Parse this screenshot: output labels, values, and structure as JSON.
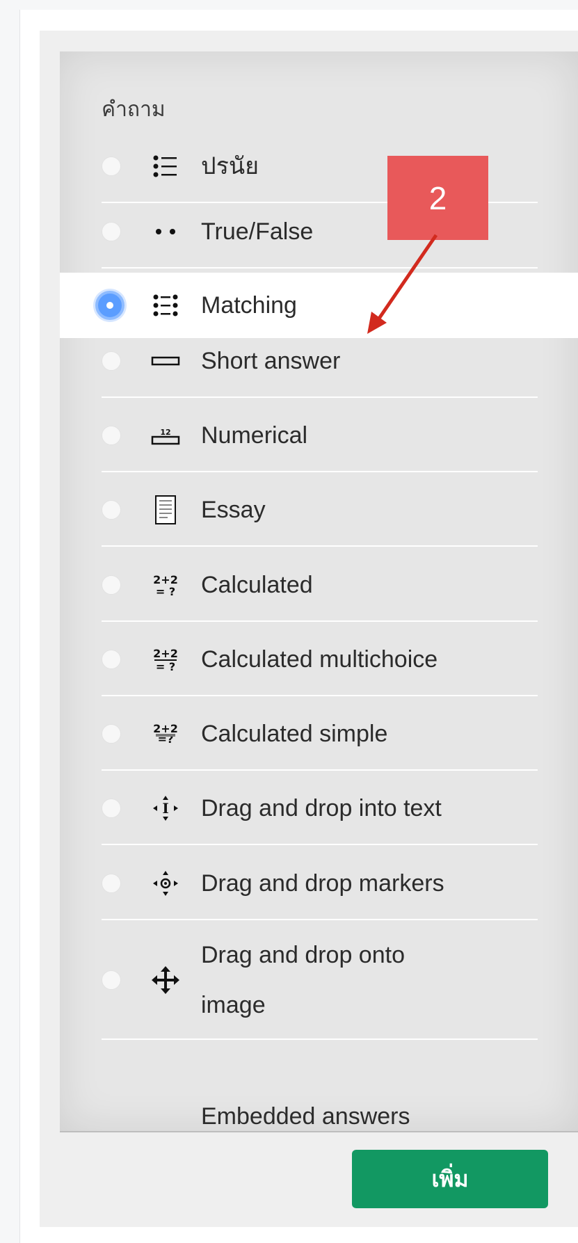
{
  "panel": {
    "section_title": "คำถาม",
    "items": [
      {
        "label": "ปรนัย",
        "icon": "multichoice-list-icon",
        "selected": false
      },
      {
        "label": "True/False",
        "icon": "two-dots-icon",
        "selected": false
      },
      {
        "label": "Matching",
        "icon": "matching-grid-icon",
        "selected": true
      },
      {
        "label": "Short answer",
        "icon": "text-box-icon",
        "selected": false
      },
      {
        "label": "Numerical",
        "icon": "numeric-box-icon",
        "selected": false
      },
      {
        "label": "Essay",
        "icon": "document-lines-icon",
        "selected": false
      },
      {
        "label": "Calculated",
        "icon": "equation-icon",
        "selected": false
      },
      {
        "label": "Calculated multichoice",
        "icon": "equation-list-icon",
        "selected": false
      },
      {
        "label": "Calculated simple",
        "icon": "equation-simple-icon",
        "selected": false
      },
      {
        "label": "Drag and drop into text",
        "icon": "drag-text-icon",
        "selected": false
      },
      {
        "label": "Drag and drop markers",
        "icon": "drag-markers-icon",
        "selected": false
      },
      {
        "label": "Drag and drop onto image",
        "icon": "move-cross-icon",
        "selected": false
      },
      {
        "label": "Embedded answers",
        "icon": "",
        "selected": false
      }
    ]
  },
  "annotation": {
    "label": "2",
    "color": "#e8595a",
    "arrow_color": "#d22a1e"
  },
  "footer": {
    "add_label": "เพิ่ม",
    "add_color": "#129862"
  }
}
